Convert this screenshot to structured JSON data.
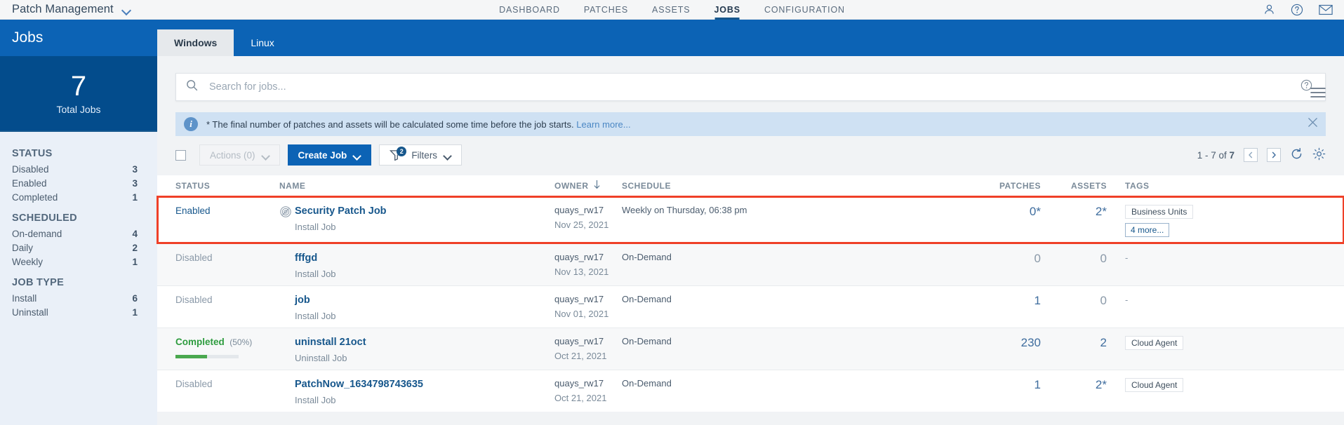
{
  "header": {
    "brand_title": "Patch Management",
    "nav": [
      {
        "label": "DASHBOARD",
        "active": false
      },
      {
        "label": "PATCHES",
        "active": false
      },
      {
        "label": "ASSETS",
        "active": false
      },
      {
        "label": "JOBS",
        "active": true
      },
      {
        "label": "CONFIGURATION",
        "active": false
      }
    ],
    "icons": [
      "user-icon",
      "help-icon",
      "mail-icon"
    ]
  },
  "sidebar": {
    "title": "Jobs",
    "stat_number": "7",
    "stat_label": "Total Jobs",
    "groups": [
      {
        "title": "STATUS",
        "items": [
          {
            "label": "Disabled",
            "count": "3"
          },
          {
            "label": "Enabled",
            "count": "3"
          },
          {
            "label": "Completed",
            "count": "1"
          }
        ]
      },
      {
        "title": "SCHEDULED",
        "items": [
          {
            "label": "On-demand",
            "count": "4"
          },
          {
            "label": "Daily",
            "count": "2"
          },
          {
            "label": "Weekly",
            "count": "1"
          }
        ]
      },
      {
        "title": "JOB TYPE",
        "items": [
          {
            "label": "Install",
            "count": "6"
          },
          {
            "label": "Uninstall",
            "count": "1"
          }
        ]
      }
    ]
  },
  "tabs": [
    {
      "label": "Windows",
      "active": true
    },
    {
      "label": "Linux",
      "active": false
    }
  ],
  "search": {
    "placeholder": "Search for jobs...",
    "value": ""
  },
  "banner": {
    "text": "* The final number of patches and assets will be calculated some time before the job starts.",
    "link": "Learn more..."
  },
  "toolbar": {
    "actions_label": "Actions (0)",
    "create_label": "Create Job",
    "filters_label": "Filters",
    "filters_badge": "2",
    "pager_range": "1 - 7 of ",
    "pager_total": "7"
  },
  "table": {
    "columns": [
      "STATUS",
      "NAME",
      "OWNER",
      "SCHEDULE",
      "PATCHES",
      "ASSETS",
      "TAGS"
    ],
    "sorted_column": "OWNER",
    "sort_direction": "desc",
    "rows": [
      {
        "status": "Enabled",
        "status_kind": "enabled",
        "progress_pct": null,
        "has_job_icon": true,
        "name": "Security Patch Job",
        "type": "Install Job",
        "owner": "quays_rw17",
        "date": "Nov 25, 2021",
        "schedule": "Weekly on Thursday, 06:38 pm",
        "patches": "0*",
        "assets": "2*",
        "tags": [
          "Business Units"
        ],
        "tags_more": "4 more...",
        "highlighted": true
      },
      {
        "status": "Disabled",
        "status_kind": "disabled",
        "progress_pct": null,
        "has_job_icon": false,
        "name": "fffgd",
        "type": "Install Job",
        "owner": "quays_rw17",
        "date": "Nov 13, 2021",
        "schedule": "On-Demand",
        "patches": "0",
        "assets": "0",
        "tags": [],
        "tags_more": null,
        "tags_empty": "-",
        "highlighted": false
      },
      {
        "status": "Disabled",
        "status_kind": "disabled",
        "progress_pct": null,
        "has_job_icon": false,
        "name": "job",
        "type": "Install Job",
        "owner": "quays_rw17",
        "date": "Nov 01, 2021",
        "schedule": "On-Demand",
        "patches": "1",
        "assets": "0",
        "tags": [],
        "tags_more": null,
        "tags_empty": "-",
        "highlighted": false
      },
      {
        "status": "Completed",
        "status_kind": "completed",
        "status_pct": "(50%)",
        "progress_pct": 50,
        "has_job_icon": false,
        "name": "uninstall 21oct",
        "type": "Uninstall Job",
        "owner": "quays_rw17",
        "date": "Oct 21, 2021",
        "schedule": "On-Demand",
        "patches": "230",
        "assets": "2",
        "tags": [
          "Cloud Agent"
        ],
        "tags_more": null,
        "highlighted": false
      },
      {
        "status": "Disabled",
        "status_kind": "disabled",
        "progress_pct": null,
        "has_job_icon": false,
        "name": "PatchNow_1634798743635",
        "type": "Install Job",
        "owner": "quays_rw17",
        "date": "Oct 21, 2021",
        "schedule": "On-Demand",
        "patches": "1",
        "assets": "2*",
        "tags": [
          "Cloud Agent"
        ],
        "tags_more": null,
        "highlighted": false
      }
    ]
  },
  "colors": {
    "brand_blue": "#0c63b5",
    "dark_blue": "#034c8c",
    "link_blue": "#17578c",
    "highlight_red": "#ef4028",
    "success_green": "#2e9c3f"
  }
}
